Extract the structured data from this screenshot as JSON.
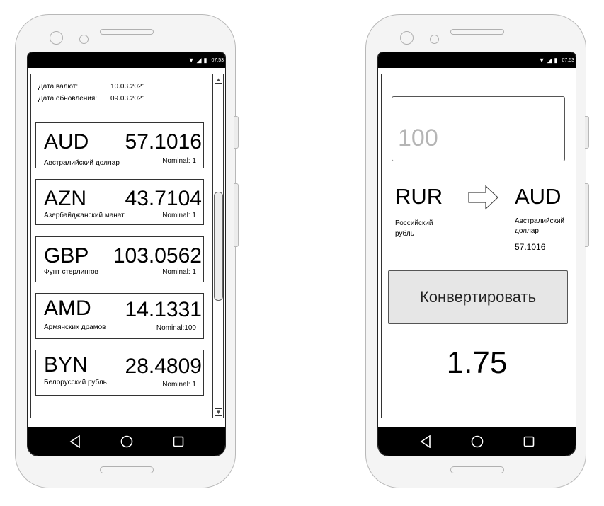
{
  "status_bar": {
    "time": "07:53"
  },
  "rates_screen": {
    "currency_date_label": "Дата валют:",
    "currency_date": "10.03.2021",
    "update_date_label": "Дата обновления:",
    "update_date": "09.03.2021",
    "currencies": [
      {
        "code": "AUD",
        "rate": "57.1016",
        "name": "Австралийский доллар",
        "nominal": "Nominal: 1"
      },
      {
        "code": "AZN",
        "rate": "43.7104",
        "name": "Азербайджанский манат",
        "nominal": "Nominal: 1"
      },
      {
        "code": "GBP",
        "rate": "103.0562",
        "name": "Фунт стерлингов",
        "nominal": "Nominal: 1"
      },
      {
        "code": "AMD",
        "rate": "14.1331",
        "name": "Армянских драмов",
        "nominal": "Nominal:100"
      },
      {
        "code": "BYN",
        "rate": "28.4809",
        "name": "Белорусский рубль",
        "nominal": "Nominal: 1"
      }
    ]
  },
  "converter_screen": {
    "amount_placeholder": "100",
    "from_code": "RUR",
    "from_name": "Российский рубль",
    "to_code": "AUD",
    "to_name": "Австралийский доллар",
    "to_rate": "57.1016",
    "convert_label": "Конвертировать",
    "result": "1.75"
  },
  "icons": {
    "status": [
      "wifi-icon",
      "signal-icon",
      "battery-icon"
    ],
    "nav": [
      "back-icon",
      "home-icon",
      "recents-icon"
    ],
    "arrow": "arrow-right-icon"
  }
}
